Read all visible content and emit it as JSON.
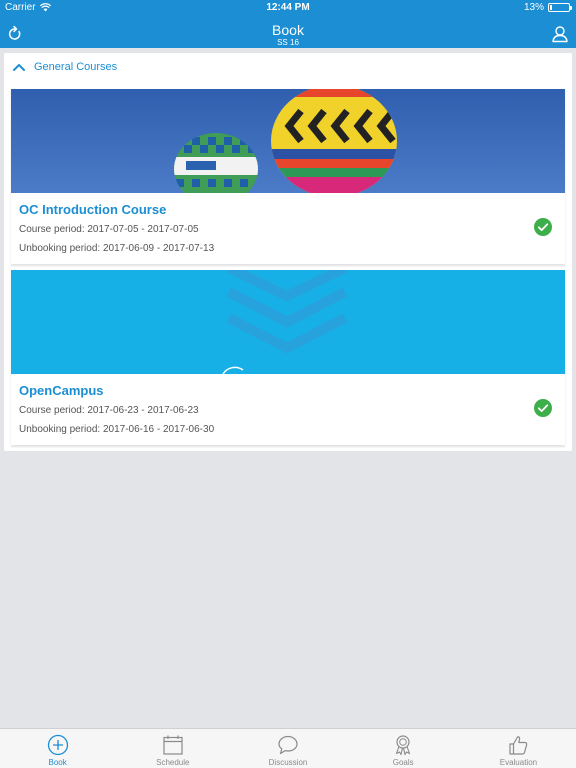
{
  "status_bar": {
    "carrier": "Carrier",
    "time": "12:44 PM",
    "battery": "13%",
    "battery_level": 0.13
  },
  "nav": {
    "title": "Book",
    "subtitle": "SS 16"
  },
  "section": {
    "title": "General Courses"
  },
  "courses": [
    {
      "title": "OC Introduction Course",
      "course_period": "Course period: 2017-07-05 - 2017-07-05",
      "unbooking_period": "Unbooking period: 2017-06-09 - 2017-07-13",
      "banner": "balloons",
      "booked": true
    },
    {
      "title": "OpenCampus",
      "course_period": "Course period: 2017-06-23 - 2017-06-23",
      "unbooking_period": "Unbooking period: 2017-06-16 - 2017-06-30",
      "banner": "opencampus-logo",
      "booked": true
    }
  ],
  "tabs": [
    {
      "label": "Book",
      "icon": "plus-circle-icon",
      "active": true
    },
    {
      "label": "Schedule",
      "icon": "calendar-icon",
      "active": false
    },
    {
      "label": "Discussion",
      "icon": "chat-bubble-icon",
      "active": false
    },
    {
      "label": "Goals",
      "icon": "award-icon",
      "active": false
    },
    {
      "label": "Evaluation",
      "icon": "thumbs-up-icon",
      "active": false
    }
  ],
  "colors": {
    "accent": "#1c8ed3",
    "success": "#3cae4a",
    "background": "#e2e4e7"
  }
}
